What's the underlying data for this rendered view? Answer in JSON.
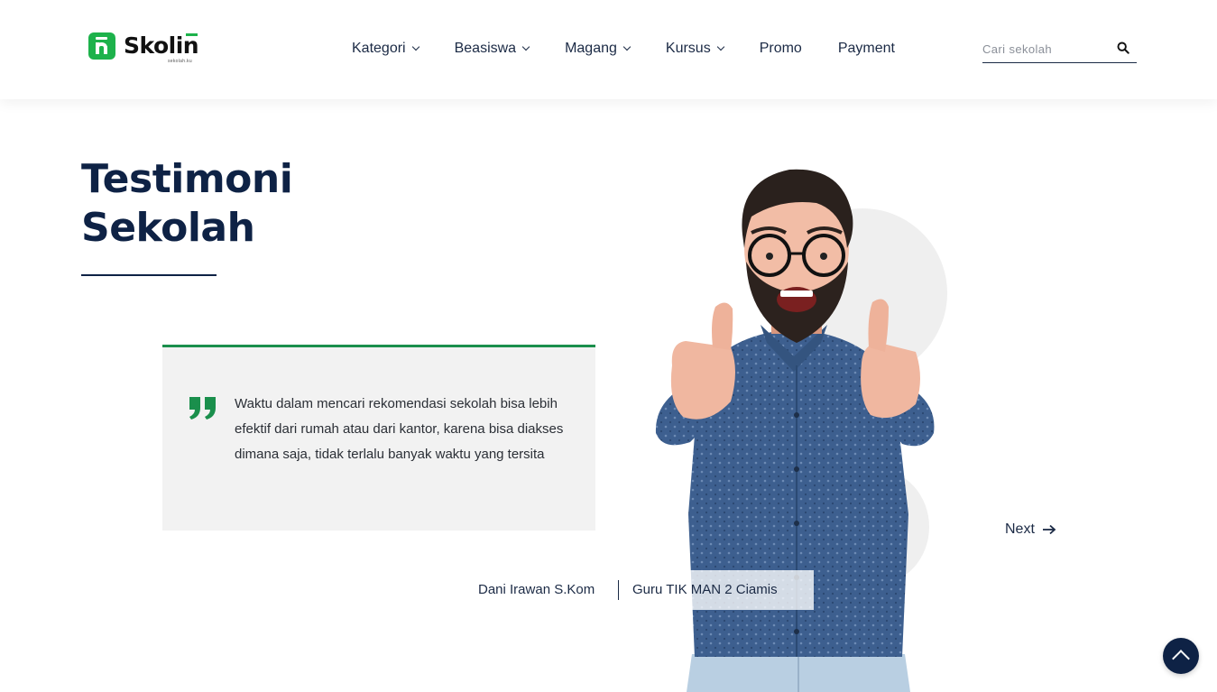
{
  "brand": {
    "name": "Skolin",
    "tagline": "sekolah.ku",
    "accent_color": "#1db24b",
    "primary_color": "#0e2245"
  },
  "nav": {
    "items": [
      {
        "label": "Kategori",
        "dropdown": true
      },
      {
        "label": "Beasiswa",
        "dropdown": true
      },
      {
        "label": "Magang",
        "dropdown": true
      },
      {
        "label": "Kursus",
        "dropdown": true
      },
      {
        "label": "Promo",
        "dropdown": false
      },
      {
        "label": "Payment",
        "dropdown": false
      }
    ]
  },
  "search": {
    "placeholder": "Cari sekolah",
    "value": ""
  },
  "section": {
    "title_line1": "Testimoni",
    "title_line2": "Sekolah"
  },
  "testimonial": {
    "quote": "Waktu dalam mencari rekomendasi sekolah bisa lebih efektif dari rumah atau dari kantor, karena bisa diakses dimana saja, tidak terlalu banyak waktu yang tersita",
    "author_name": "Dani Irawan S.Kom",
    "author_role": "Guru TIK MAN 2 Ciamis",
    "card_accent_color": "#1a8f4c"
  },
  "controls": {
    "next_label": "Next"
  },
  "icons": {
    "search": "search-icon",
    "quote": "quote-icon",
    "next": "arrow-right-icon",
    "to_top": "chevron-up-icon"
  }
}
